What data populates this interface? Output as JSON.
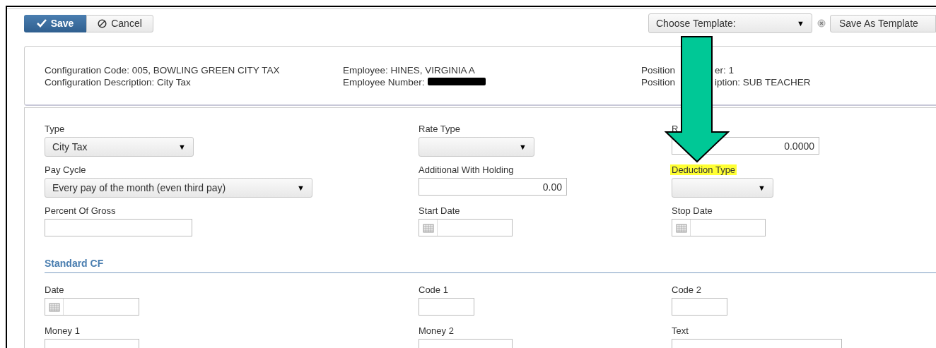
{
  "toolbar": {
    "save": "Save",
    "cancel": "Cancel",
    "template_select": {
      "value": "Choose Template:",
      "arrow": "▼"
    },
    "save_as_template": "Save As Template"
  },
  "info": {
    "columns": [
      [
        {
          "parts": [
            "Configuration Code: 005, BOWLING GREEN CITY TAX"
          ],
          "redacted": false
        },
        {
          "parts": [
            "Configuration Description: City Tax"
          ],
          "redacted": false
        }
      ],
      [
        {
          "parts": [
            "Employee: HINES, VIRGINIA A"
          ],
          "redacted": false
        },
        {
          "parts": [
            "Employee Number:"
          ],
          "redacted": true
        }
      ],
      [
        {
          "parts": [
            "Position",
            "er: 1"
          ],
          "redacted": false
        },
        {
          "parts": [
            "Position",
            "iption: SUB TEACHER"
          ],
          "redacted": false
        }
      ]
    ]
  },
  "sections": [
    {
      "rows": [
        [
          {
            "label": "Type",
            "kind": "select",
            "value": "City Tax",
            "arrow": "▼",
            "highlighted": false
          },
          {
            "label": "Rate Type",
            "kind": "select",
            "arrow": "▼",
            "highlighted": false
          },
          {
            "label": "R",
            "kind": "number",
            "value": "0.0000",
            "highlighted": false
          }
        ],
        [
          {
            "label": "Pay Cycle",
            "kind": "select",
            "value": "Every pay of the month (even third pay)",
            "arrow": "▼",
            "highlighted": false
          },
          {
            "label": "Additional With Holding",
            "kind": "number",
            "value": "0.00",
            "highlighted": false
          },
          {
            "label": "Deduction Type",
            "kind": "select",
            "arrow": "▼",
            "highlighted": true
          }
        ],
        [
          {
            "label": "Percent Of Gross",
            "kind": "text",
            "highlighted": false
          },
          {
            "label": "Start Date",
            "kind": "date",
            "highlighted": false
          },
          {
            "label": "Stop Date",
            "kind": "date",
            "highlighted": false
          }
        ]
      ]
    },
    {
      "title": "Standard CF",
      "rows": [
        [
          {
            "label": "Date",
            "kind": "date",
            "highlighted": false
          },
          {
            "label": "Code 1",
            "kind": "text",
            "highlighted": false
          },
          {
            "label": "Code 2",
            "kind": "text",
            "highlighted": false
          }
        ],
        [
          {
            "label": "Money 1",
            "kind": "text",
            "highlighted": false
          },
          {
            "label": "Money 2",
            "kind": "text",
            "highlighted": false
          },
          {
            "label": "Text",
            "kind": "text",
            "highlighted": false
          }
        ]
      ]
    }
  ]
}
